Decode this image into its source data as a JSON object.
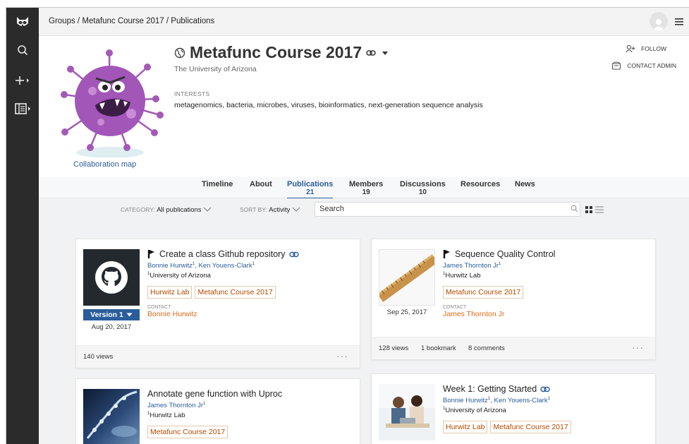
{
  "breadcrumb": [
    "Groups",
    "/",
    "Metafunc Course 2017",
    "/",
    "Publications"
  ],
  "group": {
    "title": "Metafunc Course 2017",
    "institution": "The University of Arizona",
    "interests_label": "INTERESTS",
    "interests": "metagenomics, bacteria, microbes, viruses, bioinformatics, next-generation sequence analysis",
    "collab_map": "Collaboration map"
  },
  "actions": {
    "follow": "FOLLOW",
    "contact_admin": "CONTACT ADMIN"
  },
  "tabs": [
    {
      "label": "Timeline",
      "count": ""
    },
    {
      "label": "About",
      "count": ""
    },
    {
      "label": "Publications",
      "count": "21"
    },
    {
      "label": "Members",
      "count": "19"
    },
    {
      "label": "Discussions",
      "count": "10"
    },
    {
      "label": "Resources",
      "count": ""
    },
    {
      "label": "News",
      "count": ""
    }
  ],
  "filters": {
    "category_label": "CATEGORY:",
    "category_value": "All publications",
    "sort_label": "SORT BY:",
    "sort_value": "Activity",
    "search_placeholder": "Search"
  },
  "cards": [
    {
      "title": "Create a class Github repository",
      "authors": [
        "Bonnie Hurwitz",
        "Ken Youens-Clark"
      ],
      "author_sup": "1",
      "affiliation": "University of Arizona",
      "tags": [
        "Hurwitz Lab",
        "Metafunc Course 2017"
      ],
      "version": "Version 1",
      "date": "Aug 20, 2017",
      "contact_label": "CONTACT",
      "contact": "Bonnie Hurwitz",
      "views": "140 views"
    },
    {
      "title": "Sequence Quality Control",
      "authors": [
        "James Thornton Jr"
      ],
      "author_sup": "1",
      "affiliation": "Hurwitz Lab",
      "tags": [
        "Metafunc Course 2017"
      ],
      "date": "Sep 25, 2017",
      "contact_label": "CONTACT",
      "contact": "James Thornton Jr",
      "views": "128 views",
      "bookmarks": "1 bookmark",
      "comments": "8 comments"
    },
    {
      "title": "Annotate gene function with Uproc",
      "authors": [
        "James Thornton Jr"
      ],
      "author_sup": "1",
      "affiliation": "Hurwitz Lab",
      "tags": [
        "Metafunc Course 2017"
      ]
    },
    {
      "title": "Week 1: Getting Started",
      "authors": [
        "Bonnie Hurwitz",
        "Ken Youens-Clark"
      ],
      "author_sup": "1",
      "affiliation": "University of Arizona",
      "tags": [
        "Hurwitz Lab",
        "Metafunc Course 2017"
      ]
    }
  ],
  "colors": {
    "accent": "#2a5d9c",
    "tag_text": "#b44a00",
    "contact": "#e0691a",
    "rail": "#2b2b2b"
  }
}
